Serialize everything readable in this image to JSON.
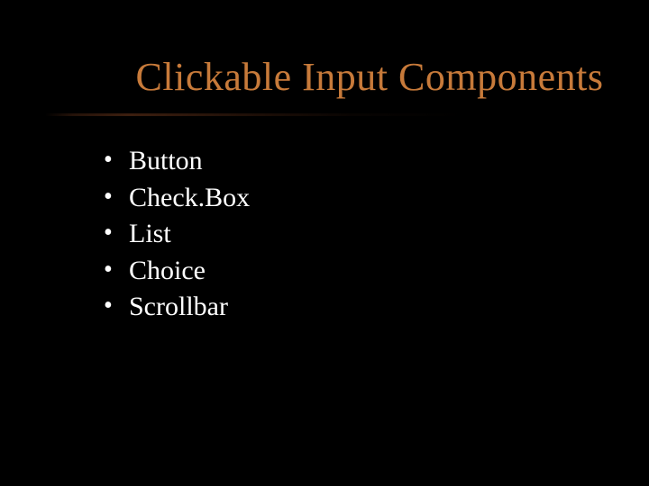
{
  "slide": {
    "title": "Clickable Input Components",
    "bullets": [
      "Button",
      "Check.Box",
      "List",
      "Choice",
      "Scrollbar"
    ]
  }
}
